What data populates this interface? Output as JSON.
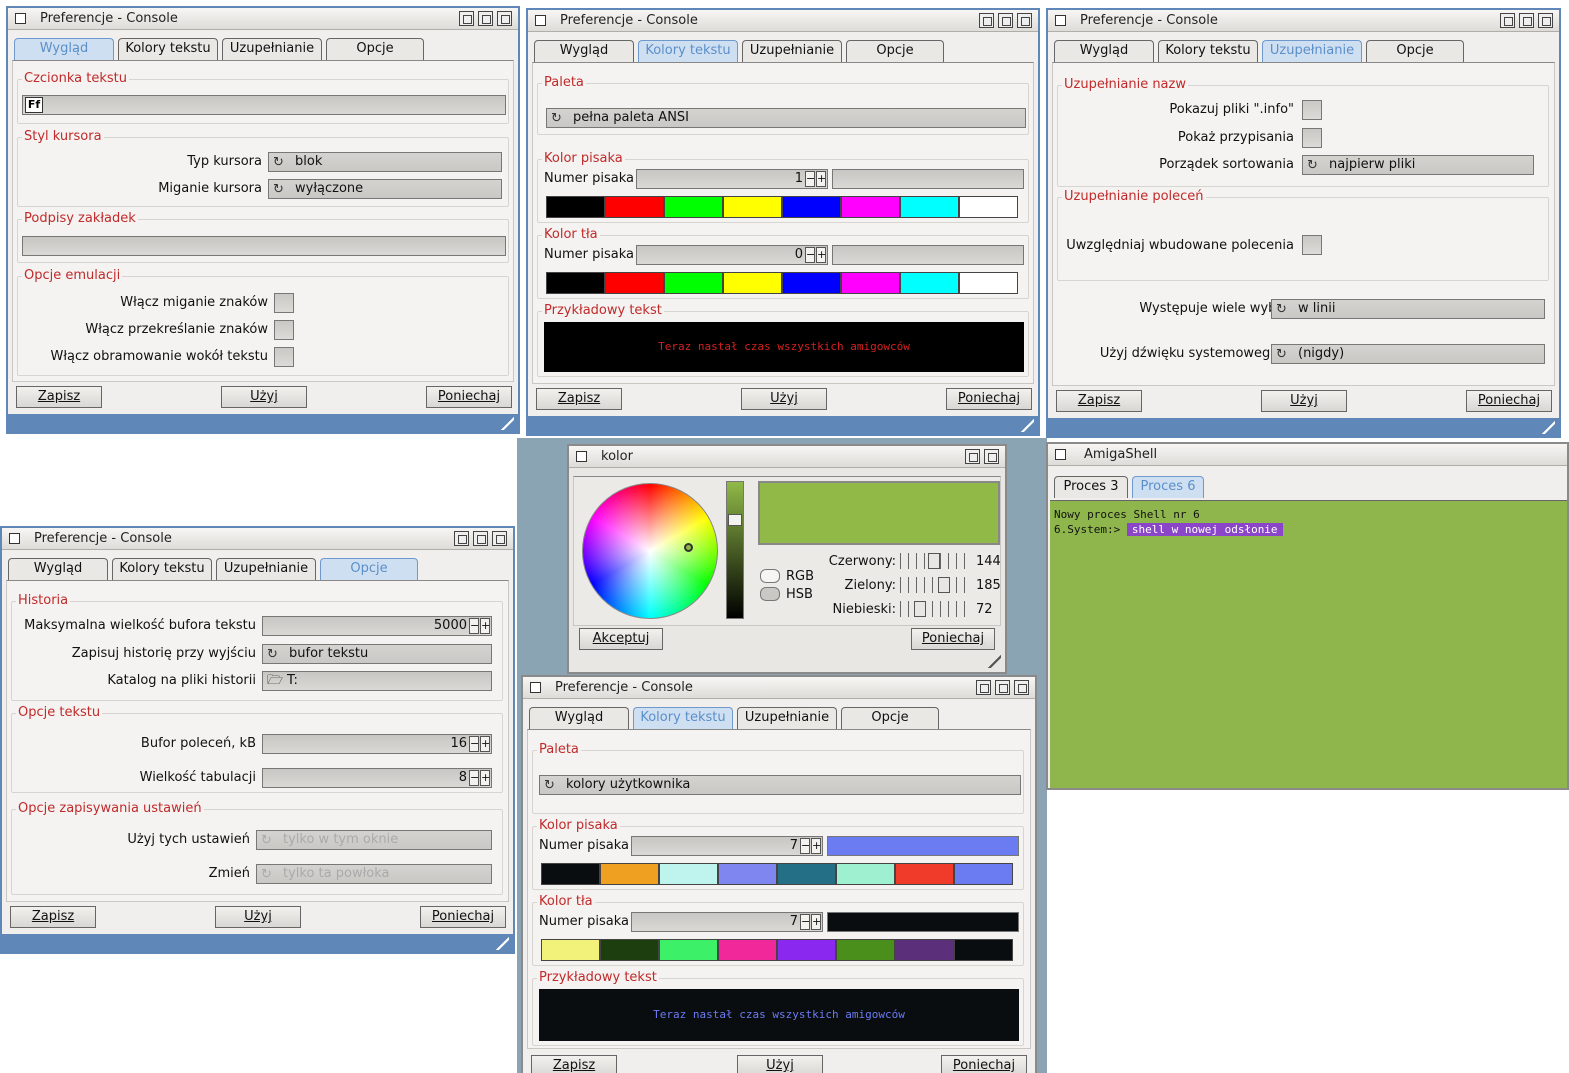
{
  "window_title": "Preferencje - Console",
  "tabs": [
    "Wygląd",
    "Kolory tekstu",
    "Uzupełnianie",
    "Opcje"
  ],
  "buttons": {
    "save": "Zapisz",
    "use": "Użyj",
    "cancel": "Poniechaj"
  },
  "appearance": {
    "font_group": "Czcionka tekstu",
    "font_icon": "Ff",
    "cursor_group": "Styl kursora",
    "cursor_type_label": "Typ kursora",
    "cursor_type_value": "blok",
    "cursor_blink_label": "Miganie kursora",
    "cursor_blink_value": "wyłączone",
    "tab_captions_group": "Podpisy zakładek",
    "emulation_group": "Opcje emulacji",
    "emu_blink": "Włącz miganie znaków",
    "emu_strike": "Włącz przekreślanie znaków",
    "emu_frame": "Włącz obramowanie wokół tekstu"
  },
  "colors1": {
    "palette_group": "Paleta",
    "palette_value": "pełna paleta ANSI",
    "pen_group": "Kolor pisaka",
    "pen_label": "Numer pisaka",
    "pen_value": "1",
    "bg_group": "Kolor tła",
    "bg_label": "Numer pisaka",
    "bg_value": "0",
    "sample_group": "Przykładowy tekst",
    "sample_text": "Teraz nastał czas wszystkich amigowców",
    "pen_swatches": [
      "#000000",
      "#ff0000",
      "#00ff00",
      "#ffff00",
      "#0000ff",
      "#ff00ff",
      "#00ffff",
      "#ffffff"
    ],
    "bg_swatches": [
      "#000000",
      "#ff0000",
      "#00ff00",
      "#ffff00",
      "#0000ff",
      "#ff00ff",
      "#00ffff",
      "#ffffff"
    ],
    "sample_color": "#d42020"
  },
  "completion": {
    "names_group": "Uzupełnianie nazw",
    "show_info": "Pokazuj pliki \".info\"",
    "show_assigns": "Pokaż przypisania",
    "sort_label": "Porządek sortowania",
    "sort_value": "najpierw pliki",
    "commands_group": "Uzupełnianie poleceń",
    "builtin_label": "Uwzględniaj wbudowane polecenia",
    "multi_label": "Występuje wiele wyborów",
    "multi_value": "w linii",
    "sound_label": "Użyj dźwięku systemowego jeśli",
    "sound_value": "(nigdy)"
  },
  "options": {
    "history_group": "Historia",
    "buffer_label": "Maksymalna wielkość bufora tekstu",
    "buffer_value": "5000",
    "save_history_label": "Zapisuj historię przy wyjściu",
    "save_history_value": "bufor tekstu",
    "history_dir_label": "Katalog na pliki historii",
    "history_dir_value": "T:",
    "text_group": "Opcje tekstu",
    "cmd_buffer_label": "Bufor poleceń, kB",
    "cmd_buffer_value": "16",
    "tab_size_label": "Wielkość tabulacji",
    "tab_size_value": "8",
    "save_group": "Opcje zapisywania ustawień",
    "use_settings_label": "Użyj tych ustawień",
    "use_settings_value": "tylko w tym oknie",
    "change_label": "Zmień",
    "change_value": "tylko ta powłoka"
  },
  "color_picker": {
    "title": "kolor",
    "preview_color": "#90b948",
    "rgb_label": "RGB",
    "hsb_label": "HSB",
    "red_label": "Czerwony:",
    "red_value": "144",
    "green_label": "Zielony:",
    "green_value": "185",
    "blue_label": "Niebieski:",
    "blue_value": "72",
    "accept": "Akceptuj",
    "cancel": "Poniechaj"
  },
  "colors2": {
    "palette_group": "Paleta",
    "palette_value": "kolory użytkownika",
    "pen_group": "Kolor pisaka",
    "pen_label": "Numer pisaka",
    "pen_value": "7",
    "bg_group": "Kolor tła",
    "bg_label": "Numer pisaka",
    "bg_value": "7",
    "sample_group": "Przykładowy tekst",
    "sample_text": "Teraz nastał czas wszystkich amigowców",
    "pen_preview": "#6b7cf2",
    "bg_preview": "#0a0d10",
    "pen_swatches": [
      "#0a0d10",
      "#f0a020",
      "#bff3ee",
      "#7f86f0",
      "#246f86",
      "#9ef0d0",
      "#f03a2a",
      "#6b7cf2"
    ],
    "bg_swatches": [
      "#f2f27a",
      "#1d3f10",
      "#3cf068",
      "#f0289a",
      "#8a28f0",
      "#4a8f1c",
      "#5b2f7a",
      "#0a0d10"
    ],
    "sample_color": "#6b7cf2"
  },
  "shell": {
    "title": "AmigaShell",
    "tabs": [
      "Proces 3",
      "Proces 6"
    ],
    "line1": "Nowy proces Shell nr 6",
    "prompt": "6.System:>",
    "command": "shell w nowej odsłonie",
    "bg_color": "#8fb64c"
  }
}
